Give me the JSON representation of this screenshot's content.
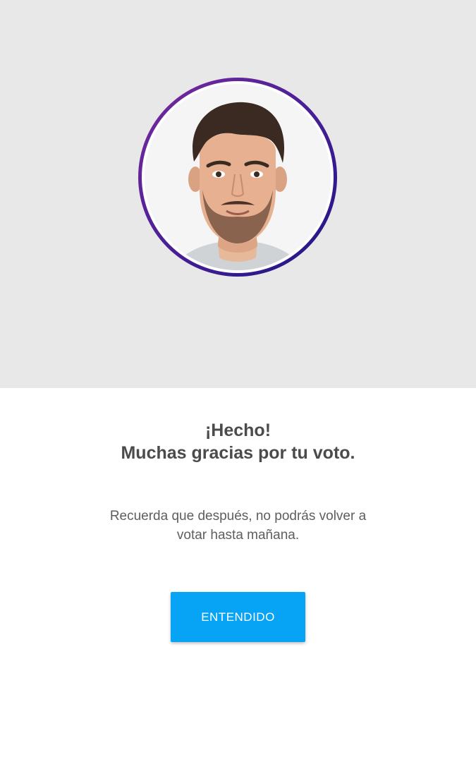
{
  "hero": {
    "background_color": "#e8e8e9",
    "avatar": {
      "description_icon": "avatar-photo",
      "ring_colors": [
        "#7a2a9e",
        "#1e1486"
      ]
    }
  },
  "confirmation": {
    "title_line1": "¡Hecho!",
    "title_line2": "Muchas gracias por tu voto.",
    "message_line1": "Recuerda que después, no podrás volver a",
    "message_line2": "votar hasta mañana."
  },
  "actions": {
    "confirm_label": "ENTENDIDO",
    "confirm_color": "#07a3f5"
  }
}
